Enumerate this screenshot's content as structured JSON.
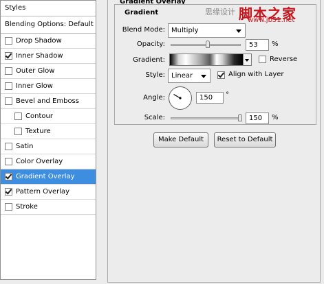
{
  "styles_panel": {
    "header": "Styles",
    "blending_options": "Blending Options: Default",
    "items": [
      {
        "label": "Drop Shadow",
        "checked": false
      },
      {
        "label": "Inner Shadow",
        "checked": true
      },
      {
        "label": "Outer Glow",
        "checked": false
      },
      {
        "label": "Inner Glow",
        "checked": false
      },
      {
        "label": "Bevel and Emboss",
        "checked": false
      },
      {
        "label": "Contour",
        "checked": false
      },
      {
        "label": "Texture",
        "checked": false
      },
      {
        "label": "Satin",
        "checked": false
      },
      {
        "label": "Color Overlay",
        "checked": false
      },
      {
        "label": "Gradient Overlay",
        "checked": true,
        "selected": true
      },
      {
        "label": "Pattern Overlay",
        "checked": true
      },
      {
        "label": "Stroke",
        "checked": false
      }
    ]
  },
  "gradient_overlay": {
    "section_title": "Gradient Overlay",
    "group_title": "Gradient",
    "blend_mode_label": "Blend Mode:",
    "blend_mode_value": "Multiply",
    "opacity_label": "Opacity:",
    "opacity_value": "53",
    "opacity_unit": "%",
    "opacity_fraction": 0.53,
    "gradient_label": "Gradient:",
    "reverse_label": "Reverse",
    "reverse_checked": false,
    "style_label": "Style:",
    "style_value": "Linear",
    "align_label": "Align with Layer",
    "align_checked": true,
    "angle_label": "Angle:",
    "angle_value": "150",
    "angle_unit": "°",
    "angle_degrees": 150,
    "scale_label": "Scale:",
    "scale_value": "150",
    "scale_unit": "%",
    "scale_fraction": 0.99
  },
  "buttons": {
    "make_default": "Make Default",
    "reset_default": "Reset to Default"
  },
  "watermark": {
    "gray_text": "思缘设计",
    "red_text": "脚本之家",
    "url": "www.jb51.net"
  },
  "colors": {
    "selection": "#3d8ee0",
    "watermark_red": "#c8141c"
  }
}
